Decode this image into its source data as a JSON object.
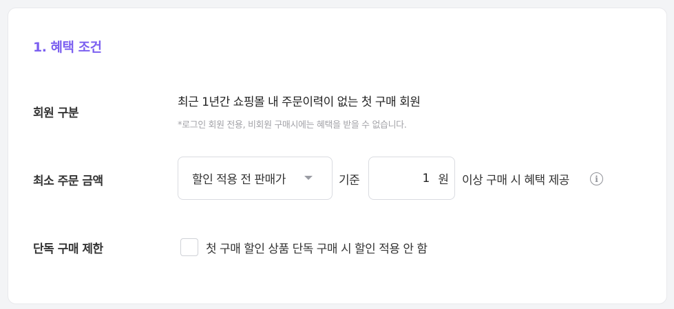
{
  "section": {
    "title": "1. 혜택 조건"
  },
  "member_type": {
    "label": "회원 구분",
    "text": "최근 1년간 쇼핑몰 내 주문이력이 없는 첫 구매 회원",
    "note": "*로그인 회원 전용, 비회원 구매시에는 혜택을 받을 수 없습니다."
  },
  "min_order": {
    "label": "최소 주문 금액",
    "select_value": "할인 적용 전 판매가",
    "basis_label": "기준",
    "amount": "1",
    "unit": "원",
    "suffix": "이상 구매 시 혜택 제공",
    "info_icon": "info-circle-icon"
  },
  "single_purchase": {
    "label": "단독 구매 제한",
    "checkbox_label": "첫 구매 할인 상품 단독 구매 시 할인 적용 안 함",
    "checked": false
  },
  "colors": {
    "accent": "#7b5ff0",
    "border": "#d9dbe0",
    "note_text": "#a3a3a8"
  }
}
